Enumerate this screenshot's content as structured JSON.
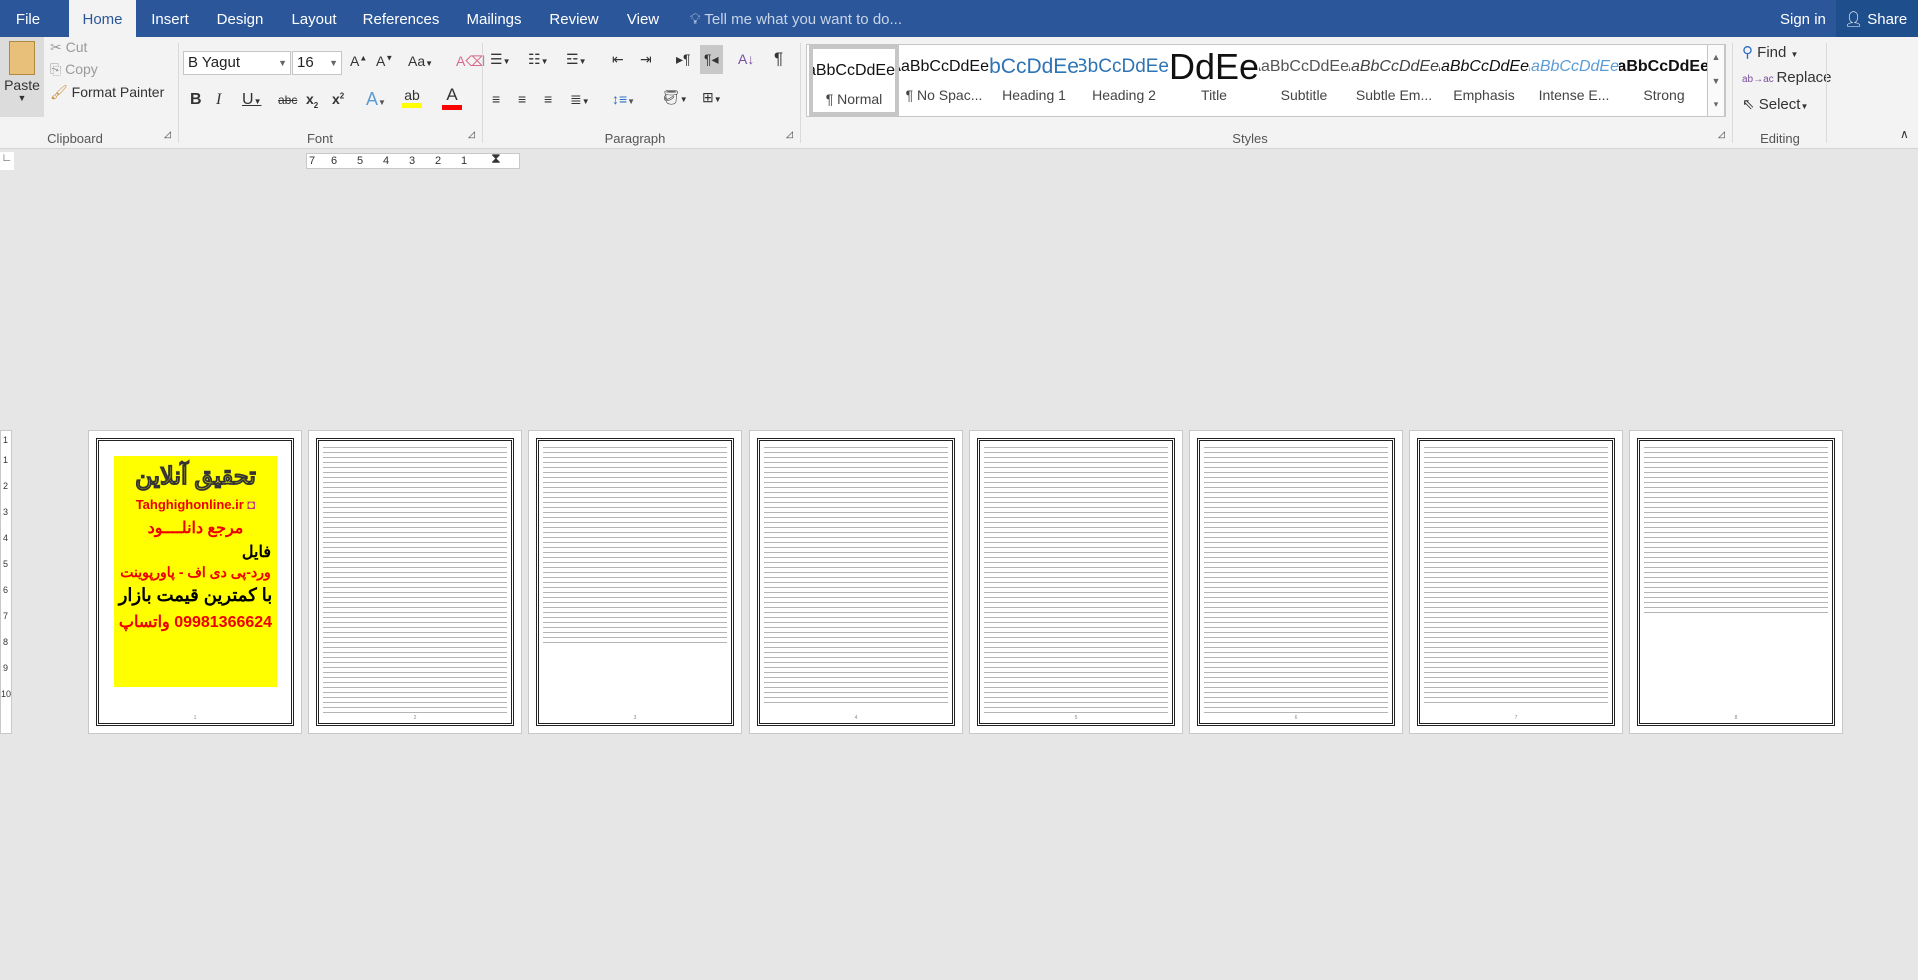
{
  "tabs": {
    "file": "File",
    "items": [
      "Home",
      "Insert",
      "Design",
      "Layout",
      "References",
      "Mailings",
      "Review",
      "View"
    ],
    "active": "Home",
    "tell_me": "Tell me what you want to do...",
    "sign_in": "Sign in",
    "share": "Share"
  },
  "clipboard": {
    "paste": "Paste",
    "cut": "Cut",
    "copy": "Copy",
    "format_painter": "Format Painter",
    "label": "Clipboard"
  },
  "font": {
    "name": "B Yagut",
    "size": "16",
    "label": "Font",
    "highlight_color": "#ffff00",
    "font_color": "#ff0000"
  },
  "paragraph": {
    "label": "Paragraph"
  },
  "styles": {
    "label": "Styles",
    "items": [
      {
        "preview": "AaBbCcDdEe",
        "name": "¶ Normal"
      },
      {
        "preview": "AaBbCcDdEe",
        "name": "¶ No Spac..."
      },
      {
        "preview": "AaBbCcDdEe",
        "name": "Heading 1"
      },
      {
        "preview": "AaBbCcDdEe",
        "name": "Heading 2"
      },
      {
        "preview": "AaBbCcDdEe",
        "name": "Title"
      },
      {
        "preview": "AaBbCcDdEe",
        "name": "Subtitle"
      },
      {
        "preview": "AaBbCcDdEe",
        "name": "Subtle Em..."
      },
      {
        "preview": "AaBbCcDdEe",
        "name": "Emphasis"
      },
      {
        "preview": "AaBbCcDdEe",
        "name": "Intense E..."
      },
      {
        "preview": "AaBbCcDdEe",
        "name": "Strong"
      }
    ]
  },
  "editing": {
    "label": "Editing",
    "find": "Find",
    "replace": "Replace",
    "select": "Select"
  },
  "ruler": {
    "marks": [
      "7",
      "6",
      "5",
      "4",
      "3",
      "2",
      "1"
    ]
  },
  "vruler": {
    "marks": [
      "1",
      "1",
      "2",
      "3",
      "4",
      "5",
      "6",
      "7",
      "8",
      "9",
      "10"
    ]
  },
  "cover": {
    "title": "تحقیق آنلاین",
    "site": "Tahghighonline.ir",
    "line1": "مرجع دانلــــود",
    "line2": "فایل",
    "line3": "ورد-پی دی اف - پاورپوینت",
    "line4": "با کمترین قیمت بازار",
    "line5": "09981366624 واتساپ"
  },
  "pages": [
    "1",
    "2",
    "3",
    "4",
    "5",
    "6",
    "7",
    "8"
  ]
}
